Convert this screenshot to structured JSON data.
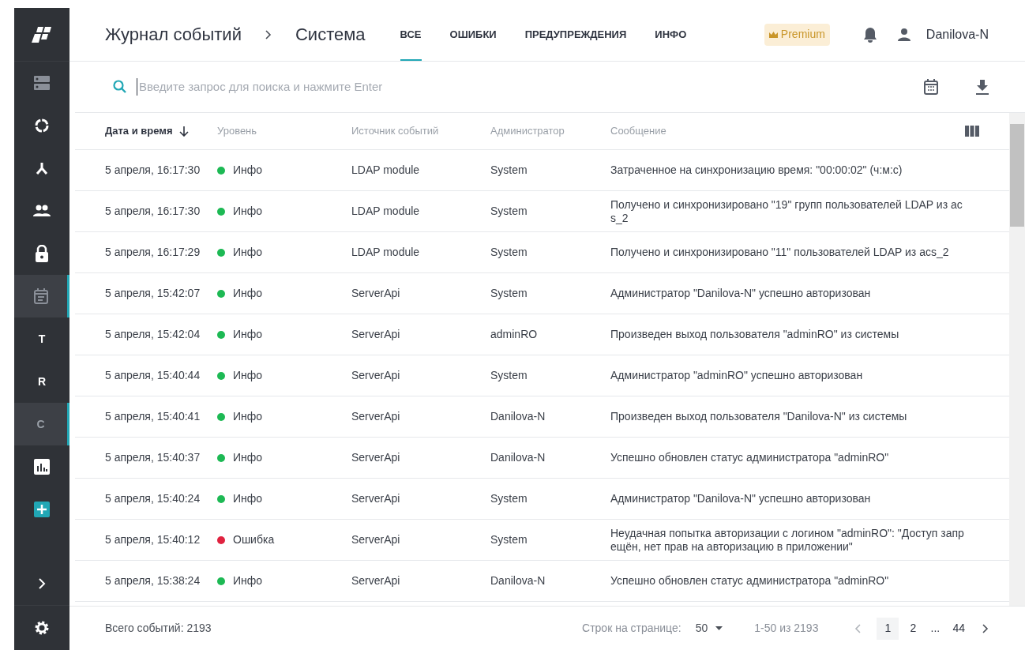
{
  "sidebar": {
    "items": [
      {
        "kind": "icon",
        "selected": false
      },
      {
        "kind": "icon",
        "selected": false
      },
      {
        "kind": "icon",
        "selected": false
      },
      {
        "kind": "icon",
        "selected": false
      },
      {
        "kind": "icon",
        "selected": false
      },
      {
        "kind": "icon",
        "selected": true
      },
      {
        "kind": "letter",
        "label": "T",
        "selected": false
      },
      {
        "kind": "letter",
        "label": "R",
        "selected": false
      },
      {
        "kind": "letter",
        "label": "C",
        "selected": true
      },
      {
        "kind": "icon",
        "selected": false
      },
      {
        "kind": "add",
        "selected": false
      }
    ]
  },
  "header": {
    "breadcrumb": [
      "Журнал событий",
      "Система"
    ],
    "tabs": [
      {
        "label": "ВСЕ",
        "selected": true
      },
      {
        "label": "ОШИБКИ",
        "selected": false
      },
      {
        "label": "ПРЕДУПРЕЖДЕНИЯ",
        "selected": false
      },
      {
        "label": "ИНФО",
        "selected": false
      }
    ],
    "badge": "Premium",
    "user": "Danilova-N"
  },
  "search": {
    "placeholder": "Введите запрос для поиска и нажмите Enter"
  },
  "table": {
    "columns": [
      "Дата и время",
      "Уровень",
      "Источник событий",
      "Администратор",
      "Сообщение"
    ],
    "rows": [
      {
        "time": "5 апреля, 16:17:30",
        "level": "Инфо",
        "color": "#1db954",
        "source": "LDAP module",
        "admin": "System",
        "message": "Затраченное на синхронизацию время: \"00:00:02\" (ч:м:с)"
      },
      {
        "time": "5 апреля, 16:17:30",
        "level": "Инфо",
        "color": "#1db954",
        "source": "LDAP module",
        "admin": "System",
        "message": "Получено и синхронизировано \"19\" групп пользователей LDAP из ac s_2"
      },
      {
        "time": "5 апреля, 16:17:29",
        "level": "Инфо",
        "color": "#1db954",
        "source": "LDAP module",
        "admin": "System",
        "message": "Получено и синхронизировано \"11\" пользователей LDAP из acs_2"
      },
      {
        "time": "5 апреля, 15:42:07",
        "level": "Инфо",
        "color": "#1db954",
        "source": "ServerApi",
        "admin": "System",
        "message": "Администратор \"Danilova-N\" успешно авторизован"
      },
      {
        "time": "5 апреля, 15:42:04",
        "level": "Инфо",
        "color": "#1db954",
        "source": "ServerApi",
        "admin": "adminRO",
        "message": "Произведен выход пользователя \"adminRO\" из системы"
      },
      {
        "time": "5 апреля, 15:40:44",
        "level": "Инфо",
        "color": "#1db954",
        "source": "ServerApi",
        "admin": "System",
        "message": "Администратор \"adminRO\" успешно авторизован"
      },
      {
        "time": "5 апреля, 15:40:41",
        "level": "Инфо",
        "color": "#1db954",
        "source": "ServerApi",
        "admin": "Danilova-N",
        "message": "Произведен выход пользователя \"Danilova-N\" из системы"
      },
      {
        "time": "5 апреля, 15:40:37",
        "level": "Инфо",
        "color": "#1db954",
        "source": "ServerApi",
        "admin": "Danilova-N",
        "message": "Успешно обновлен статус администратора \"adminRO\""
      },
      {
        "time": "5 апреля, 15:40:24",
        "level": "Инфо",
        "color": "#1db954",
        "source": "ServerApi",
        "admin": "System",
        "message": "Администратор \"Danilova-N\" успешно авторизован"
      },
      {
        "time": "5 апреля, 15:40:12",
        "level": "Ошибка",
        "color": "#e0223f",
        "source": "ServerApi",
        "admin": "System",
        "message": "Неудачная попытка авторизации с логином \"adminRO\": \"Доступ запр ещён, нет прав на авторизацию в приложении\""
      },
      {
        "time": "5 апреля, 15:38:24",
        "level": "Инфо",
        "color": "#1db954",
        "source": "ServerApi",
        "admin": "Danilova-N",
        "message": "Успешно обновлен статус администратора \"adminRO\""
      }
    ]
  },
  "footer": {
    "total": "Всего событий: 2193",
    "rows_label": "Строк на странице:",
    "rows_value": "50",
    "range": "1-50 из 2193",
    "pages": [
      {
        "label": "1",
        "selected": true
      },
      {
        "label": "2",
        "selected": false
      },
      {
        "label": "...",
        "selected": false
      },
      {
        "label": "44",
        "selected": false
      }
    ]
  }
}
